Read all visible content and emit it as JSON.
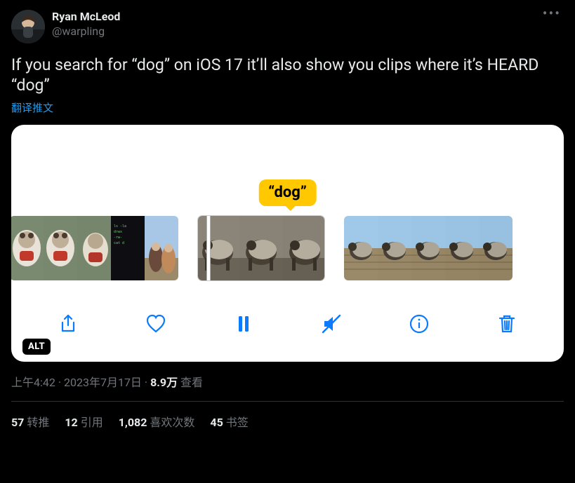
{
  "author": {
    "display_name": "Ryan McLeod",
    "handle": "@warpling"
  },
  "body": "If you search for “dog” on iOS 17 it’ll also show you clips where it’s HEARD “dog”",
  "translate_label": "翻译推文",
  "media": {
    "bubble_text": "“dog”",
    "alt_badge": "ALT"
  },
  "meta": {
    "time": "上午4:42",
    "sep1": " · ",
    "date": "2023年7月17日",
    "sep2": " · ",
    "views_count": "8.9万",
    "views_label": " 查看"
  },
  "stats": {
    "retweets": {
      "count": "57",
      "label": "转推"
    },
    "quotes": {
      "count": "12",
      "label": "引用"
    },
    "likes": {
      "count": "1,082",
      "label": "喜欢次数"
    },
    "bookmarks": {
      "count": "45",
      "label": "书签"
    }
  }
}
